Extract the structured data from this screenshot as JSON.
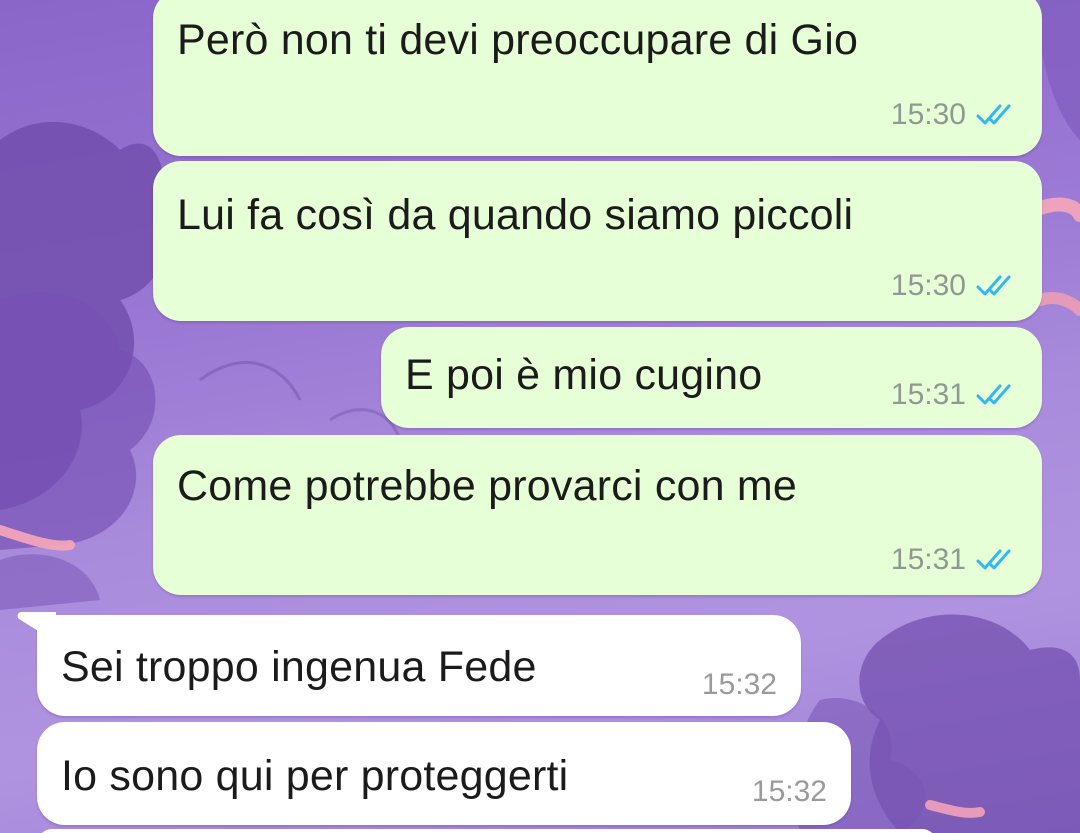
{
  "messages": [
    {
      "direction": "outgoing",
      "text": "Però non ti devi preoccupare di Gio",
      "time": "15:30",
      "status": "read",
      "status_icon": "double-check-icon"
    },
    {
      "direction": "outgoing",
      "text": "Lui fa così da quando siamo piccoli",
      "time": "15:30",
      "status": "read",
      "status_icon": "double-check-icon"
    },
    {
      "direction": "outgoing",
      "text": "E poi è mio cugino",
      "time": "15:31",
      "status": "read",
      "status_icon": "double-check-icon"
    },
    {
      "direction": "outgoing",
      "text": "Come potrebbe provarci con me",
      "time": "15:31",
      "status": "read",
      "status_icon": "double-check-icon"
    },
    {
      "direction": "incoming",
      "text": "Sei troppo ingenua Fede",
      "time": "15:32"
    },
    {
      "direction": "incoming",
      "text": "Io sono qui per proteggerti",
      "time": "15:32"
    }
  ],
  "colors": {
    "outgoing_bubble": "#e6ffd6",
    "incoming_bubble": "#ffffff",
    "read_ticks": "#34b7f1",
    "timestamp": "#8f9992",
    "wallpaper": "#9a78d4"
  }
}
